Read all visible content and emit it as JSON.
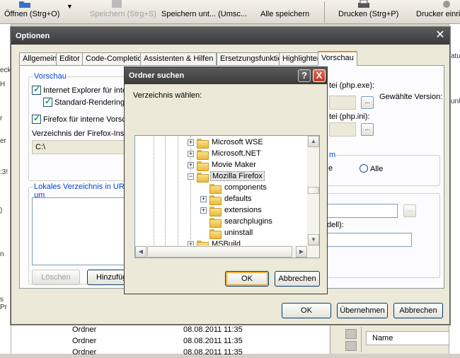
{
  "toolbar": {
    "open_label": "Öffnen (Strg+O)",
    "save_label": "Speichern (Strg+S)",
    "save_as_label": "Speichern unt... (Umsc...",
    "save_all_label": "Alle speichern",
    "print_label": "Drucken (Strg+P)",
    "printer_setup_label": "Drucker einrich"
  },
  "bg_left": {
    "fragments": [
      "eck",
      "H",
      "r",
      "er",
      ":3!",
      ")",
      "n",
      "s Pr"
    ]
  },
  "bg_right": {
    "fragments": [
      "atu",
      "unk"
    ]
  },
  "bg_list": {
    "rows": [
      {
        "type": "Ordner",
        "date": "08.08.2011",
        "time": "11:35"
      },
      {
        "type": "Ordner",
        "date": "08.08.2011",
        "time": "11:35"
      },
      {
        "type": "Ordner",
        "date": "08.08.2011",
        "time": "11:35"
      }
    ]
  },
  "bg_panel": {
    "name_header": "Name"
  },
  "optionen": {
    "title": "Optionen",
    "tabs": [
      "Allgemein",
      "Editor",
      "Code-Completion",
      "Assistenten & Hilfen",
      "Ersetzungsfunktionen",
      "Highlighter",
      "Vorschau"
    ],
    "vorschau_group": "Vorschau",
    "chk_ie": "Internet Explorer für interne V",
    "chk_std_render": "Standard-Rendering akti",
    "chk_firefox": "Firefox für interne Vorschau",
    "ff_dir_label": "Verzeichnis der Firefox-Installati",
    "ff_dir_value": "C:\\",
    "local_dir_group": "Lokales Verzeichnis in URL um",
    "loeschen_label": "Löschen",
    "hinzufuegen_label": "Hinzufüge",
    "php_exe_label": "tei (php.exe):",
    "php_ini_label": "tei (php.ini):",
    "version_label": "Gewählte Version:",
    "right_group_label": "m",
    "radio_e": "e",
    "radio_alle": "Alle",
    "field3_label": "dell):",
    "browse_label": "...",
    "ok_label": "OK",
    "apply_label": "Übernehmen",
    "cancel_label": "Abbrechen"
  },
  "suchen": {
    "title": "Ordner suchen",
    "help_label": "?",
    "close_label": "X",
    "prompt": "Verzeichnis wählen:",
    "tree": [
      {
        "name": "Microsoft WSE",
        "level": 0,
        "expander": "+"
      },
      {
        "name": "Microsoft.NET",
        "level": 0,
        "expander": "+"
      },
      {
        "name": "Movie Maker",
        "level": 0,
        "expander": "+"
      },
      {
        "name": "Mozilla Firefox",
        "level": 0,
        "expander": "−",
        "selected": true
      },
      {
        "name": "components",
        "level": 1,
        "expander": ""
      },
      {
        "name": "defaults",
        "level": 1,
        "expander": "+"
      },
      {
        "name": "extensions",
        "level": 1,
        "expander": "+"
      },
      {
        "name": "searchplugins",
        "level": 1,
        "expander": ""
      },
      {
        "name": "uninstall",
        "level": 1,
        "expander": ""
      },
      {
        "name": "MSBuild",
        "level": 0,
        "expander": "+"
      }
    ],
    "ok_label": "OK",
    "cancel_label": "Abbrechen"
  },
  "colors": {
    "title_bar": "#3a3a3a",
    "group_label": "#0046d5",
    "active_tab_accent": "#e68b2c"
  }
}
